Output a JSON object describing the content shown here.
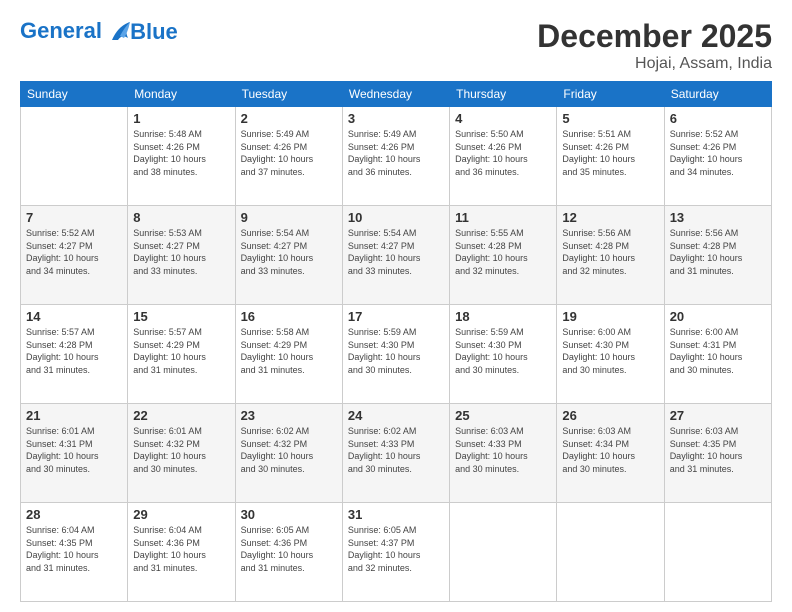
{
  "header": {
    "logo_line1": "General",
    "logo_line2": "Blue",
    "month_year": "December 2025",
    "location": "Hojai, Assam, India"
  },
  "weekdays": [
    "Sunday",
    "Monday",
    "Tuesday",
    "Wednesday",
    "Thursday",
    "Friday",
    "Saturday"
  ],
  "weeks": [
    [
      {
        "day": "",
        "info": ""
      },
      {
        "day": "1",
        "info": "Sunrise: 5:48 AM\nSunset: 4:26 PM\nDaylight: 10 hours\nand 38 minutes."
      },
      {
        "day": "2",
        "info": "Sunrise: 5:49 AM\nSunset: 4:26 PM\nDaylight: 10 hours\nand 37 minutes."
      },
      {
        "day": "3",
        "info": "Sunrise: 5:49 AM\nSunset: 4:26 PM\nDaylight: 10 hours\nand 36 minutes."
      },
      {
        "day": "4",
        "info": "Sunrise: 5:50 AM\nSunset: 4:26 PM\nDaylight: 10 hours\nand 36 minutes."
      },
      {
        "day": "5",
        "info": "Sunrise: 5:51 AM\nSunset: 4:26 PM\nDaylight: 10 hours\nand 35 minutes."
      },
      {
        "day": "6",
        "info": "Sunrise: 5:52 AM\nSunset: 4:26 PM\nDaylight: 10 hours\nand 34 minutes."
      }
    ],
    [
      {
        "day": "7",
        "info": "Sunrise: 5:52 AM\nSunset: 4:27 PM\nDaylight: 10 hours\nand 34 minutes."
      },
      {
        "day": "8",
        "info": "Sunrise: 5:53 AM\nSunset: 4:27 PM\nDaylight: 10 hours\nand 33 minutes."
      },
      {
        "day": "9",
        "info": "Sunrise: 5:54 AM\nSunset: 4:27 PM\nDaylight: 10 hours\nand 33 minutes."
      },
      {
        "day": "10",
        "info": "Sunrise: 5:54 AM\nSunset: 4:27 PM\nDaylight: 10 hours\nand 33 minutes."
      },
      {
        "day": "11",
        "info": "Sunrise: 5:55 AM\nSunset: 4:28 PM\nDaylight: 10 hours\nand 32 minutes."
      },
      {
        "day": "12",
        "info": "Sunrise: 5:56 AM\nSunset: 4:28 PM\nDaylight: 10 hours\nand 32 minutes."
      },
      {
        "day": "13",
        "info": "Sunrise: 5:56 AM\nSunset: 4:28 PM\nDaylight: 10 hours\nand 31 minutes."
      }
    ],
    [
      {
        "day": "14",
        "info": "Sunrise: 5:57 AM\nSunset: 4:28 PM\nDaylight: 10 hours\nand 31 minutes."
      },
      {
        "day": "15",
        "info": "Sunrise: 5:57 AM\nSunset: 4:29 PM\nDaylight: 10 hours\nand 31 minutes."
      },
      {
        "day": "16",
        "info": "Sunrise: 5:58 AM\nSunset: 4:29 PM\nDaylight: 10 hours\nand 31 minutes."
      },
      {
        "day": "17",
        "info": "Sunrise: 5:59 AM\nSunset: 4:30 PM\nDaylight: 10 hours\nand 30 minutes."
      },
      {
        "day": "18",
        "info": "Sunrise: 5:59 AM\nSunset: 4:30 PM\nDaylight: 10 hours\nand 30 minutes."
      },
      {
        "day": "19",
        "info": "Sunrise: 6:00 AM\nSunset: 4:30 PM\nDaylight: 10 hours\nand 30 minutes."
      },
      {
        "day": "20",
        "info": "Sunrise: 6:00 AM\nSunset: 4:31 PM\nDaylight: 10 hours\nand 30 minutes."
      }
    ],
    [
      {
        "day": "21",
        "info": "Sunrise: 6:01 AM\nSunset: 4:31 PM\nDaylight: 10 hours\nand 30 minutes."
      },
      {
        "day": "22",
        "info": "Sunrise: 6:01 AM\nSunset: 4:32 PM\nDaylight: 10 hours\nand 30 minutes."
      },
      {
        "day": "23",
        "info": "Sunrise: 6:02 AM\nSunset: 4:32 PM\nDaylight: 10 hours\nand 30 minutes."
      },
      {
        "day": "24",
        "info": "Sunrise: 6:02 AM\nSunset: 4:33 PM\nDaylight: 10 hours\nand 30 minutes."
      },
      {
        "day": "25",
        "info": "Sunrise: 6:03 AM\nSunset: 4:33 PM\nDaylight: 10 hours\nand 30 minutes."
      },
      {
        "day": "26",
        "info": "Sunrise: 6:03 AM\nSunset: 4:34 PM\nDaylight: 10 hours\nand 30 minutes."
      },
      {
        "day": "27",
        "info": "Sunrise: 6:03 AM\nSunset: 4:35 PM\nDaylight: 10 hours\nand 31 minutes."
      }
    ],
    [
      {
        "day": "28",
        "info": "Sunrise: 6:04 AM\nSunset: 4:35 PM\nDaylight: 10 hours\nand 31 minutes."
      },
      {
        "day": "29",
        "info": "Sunrise: 6:04 AM\nSunset: 4:36 PM\nDaylight: 10 hours\nand 31 minutes."
      },
      {
        "day": "30",
        "info": "Sunrise: 6:05 AM\nSunset: 4:36 PM\nDaylight: 10 hours\nand 31 minutes."
      },
      {
        "day": "31",
        "info": "Sunrise: 6:05 AM\nSunset: 4:37 PM\nDaylight: 10 hours\nand 32 minutes."
      },
      {
        "day": "",
        "info": ""
      },
      {
        "day": "",
        "info": ""
      },
      {
        "day": "",
        "info": ""
      }
    ]
  ]
}
